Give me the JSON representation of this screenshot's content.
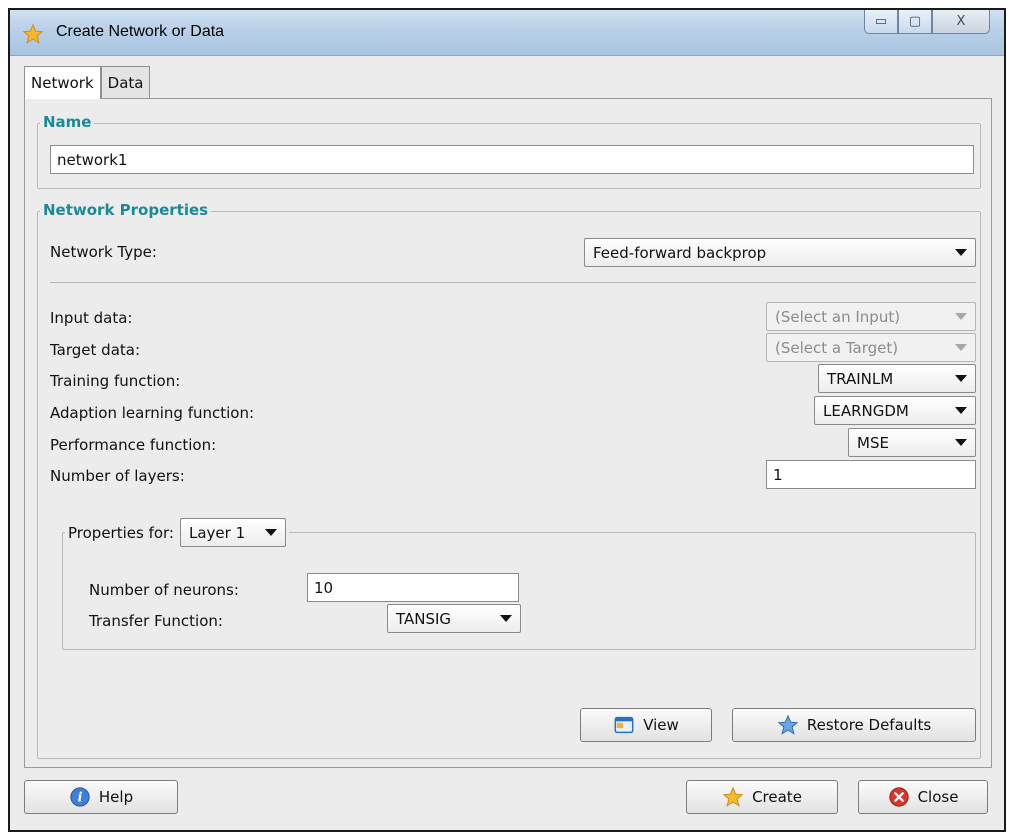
{
  "window": {
    "title": "Create Network or Data",
    "controls": {
      "minimize": "▭",
      "maximize": "▢",
      "close": "X"
    }
  },
  "tabs": [
    {
      "label": "Network",
      "active": true
    },
    {
      "label": "Data",
      "active": false
    }
  ],
  "name_group": {
    "legend": "Name",
    "value": "network1"
  },
  "properties": {
    "legend": "Network Properties",
    "network_type": {
      "label": "Network Type:",
      "value": "Feed-forward backprop"
    },
    "input_data": {
      "label": "Input data:",
      "value": "(Select an Input)"
    },
    "target_data": {
      "label": "Target data:",
      "value": "(Select a Target)"
    },
    "training_function": {
      "label": "Training function:",
      "value": "TRAINLM"
    },
    "adaption_function": {
      "label": "Adaption learning function:",
      "value": "LEARNGDM"
    },
    "performance_function": {
      "label": "Performance function:",
      "value": "MSE"
    },
    "num_layers": {
      "label": "Number of layers:",
      "value": "1"
    },
    "layer_props": {
      "label": "Properties for:",
      "layer": "Layer 1",
      "num_neurons": {
        "label": "Number of neurons:",
        "value": "10"
      },
      "transfer_function": {
        "label": "Transfer Function:",
        "value": "TANSIG"
      }
    },
    "view_button": "View",
    "restore_button": "Restore Defaults"
  },
  "footer": {
    "help_button": "Help",
    "create_button": "Create",
    "close_button": "Close"
  },
  "colors": {
    "legend_teal": "#1b8a96",
    "titlebar": "#b9d0e8"
  },
  "icons": {
    "app": "star-icon",
    "help": "info-icon",
    "view": "window-icon",
    "restore": "star-icon",
    "create": "star-icon",
    "close": "close-icon"
  }
}
